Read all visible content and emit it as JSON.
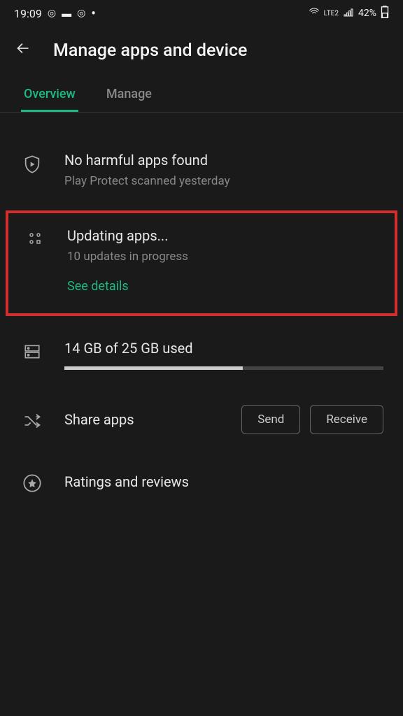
{
  "statusBar": {
    "time": "19:09",
    "battery": "42%",
    "network": "LTE2"
  },
  "header": {
    "title": "Manage apps and device"
  },
  "tabs": {
    "overview": "Overview",
    "manage": "Manage"
  },
  "playProtect": {
    "title": "No harmful apps found",
    "subtitle": "Play Protect scanned yesterday"
  },
  "updates": {
    "title": "Updating apps...",
    "subtitle": "10 updates in progress",
    "link": "See details"
  },
  "storage": {
    "text": "14 GB of 25 GB used",
    "usedPercent": 56
  },
  "share": {
    "title": "Share apps",
    "sendLabel": "Send",
    "receiveLabel": "Receive"
  },
  "ratings": {
    "title": "Ratings and reviews"
  }
}
